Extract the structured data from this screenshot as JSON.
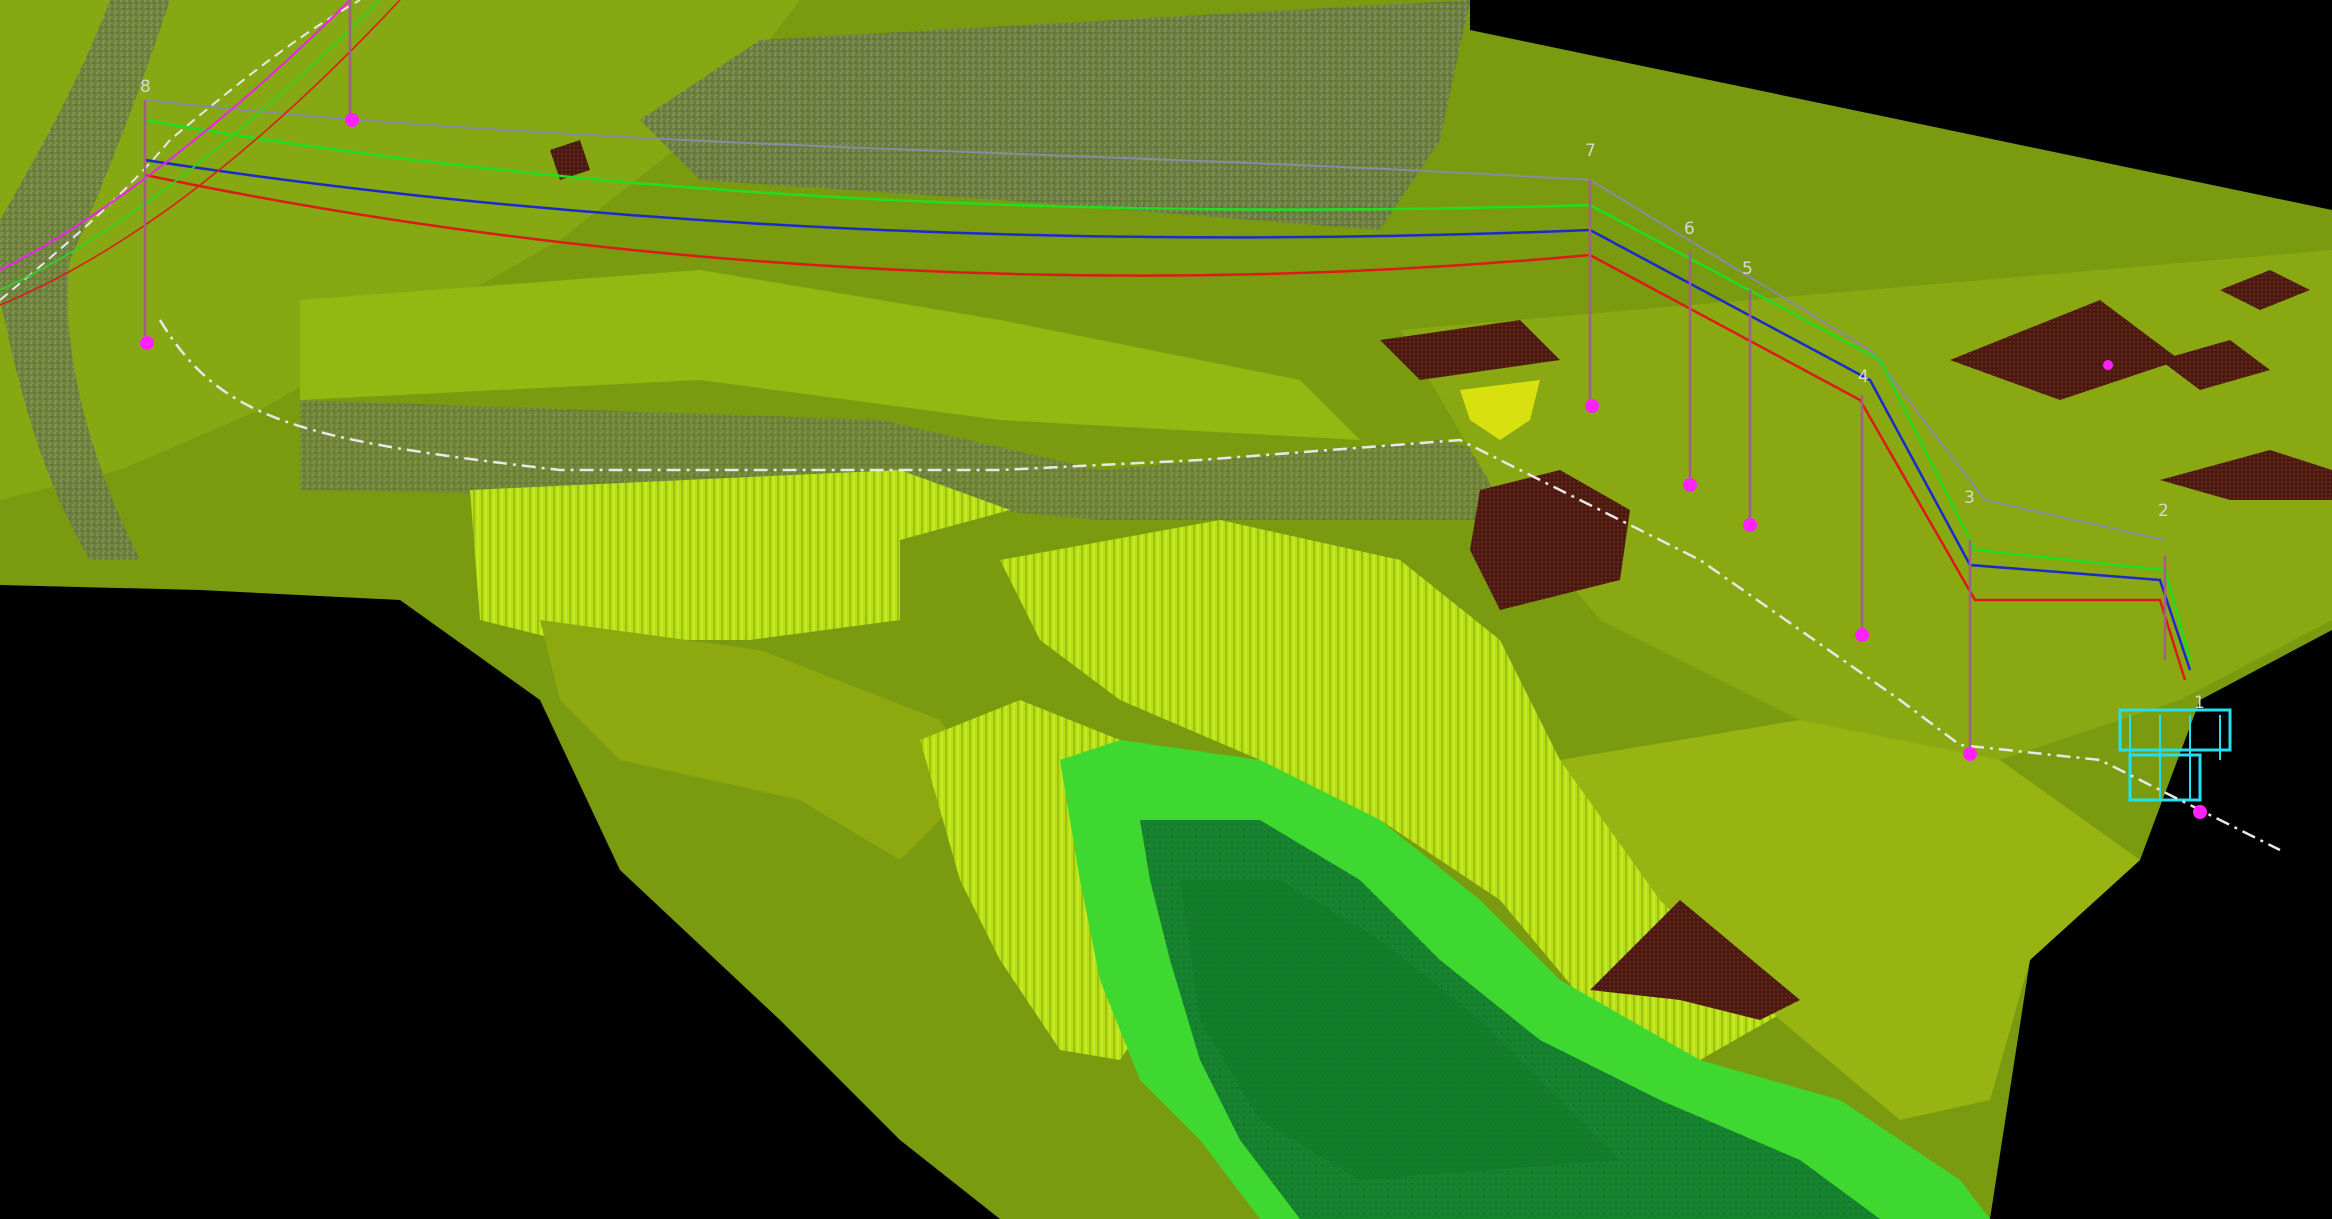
{
  "scene": {
    "background_color": "#000000",
    "terrain_colors": {
      "upland": "#7a9a10",
      "upland_light": "#8fb012",
      "slope": "#a7cf16",
      "cliff": "#c6ec1a",
      "valley_rim": "#3fd830",
      "valley_floor": "#149a2e",
      "gravel": "#5e6a58",
      "structure": "#5a1410"
    },
    "conductor_colors": {
      "green_line": "#22dd22",
      "blue_line": "#1a2acc",
      "red_line": "#dd1a1a",
      "gray_line": "#8a8aa0",
      "road_line": "#e8e8e8",
      "marker": "#ff22ff"
    }
  },
  "towers": [
    {
      "label": "8"
    },
    {
      "label": "7"
    },
    {
      "label": "6"
    },
    {
      "label": "5"
    },
    {
      "label": "4"
    },
    {
      "label": "3"
    },
    {
      "label": "2"
    },
    {
      "label": "1"
    }
  ]
}
